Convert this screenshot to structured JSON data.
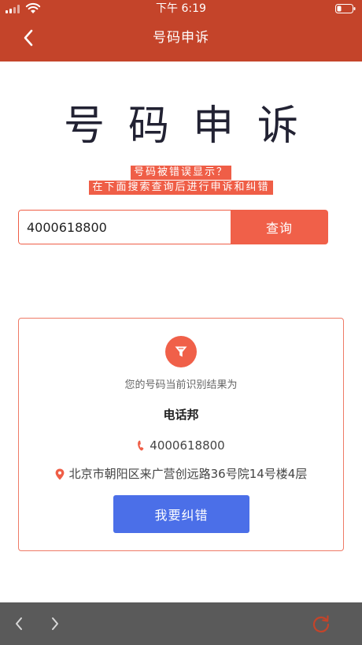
{
  "status_bar": {
    "time": "下午 6:19"
  },
  "nav": {
    "title": "号码申诉"
  },
  "hero": {
    "title": "号码申诉",
    "hint_line_1": "号码被错误显示？",
    "hint_line_2": "在下面搜索查询后进行申诉和纠错"
  },
  "search": {
    "value": "4000618800",
    "button_label": "查询"
  },
  "result": {
    "caption": "您的号码当前识别结果为",
    "name": "电话邦",
    "phone": "4000618800",
    "address": "北京市朝阳区来广营创远路36号院14号楼4层",
    "correct_button_label": "我要纠错"
  },
  "icons": {
    "back": "chevron-left-icon",
    "filter": "filter-icon",
    "phone": "phone-icon",
    "location": "location-pin-icon",
    "toolbar_back": "chevron-left-icon",
    "toolbar_forward": "chevron-right-icon",
    "toolbar_reload": "reload-icon"
  },
  "colors": {
    "header": "#c4442a",
    "accent": "#f06049",
    "primary_button": "#4b6fe8",
    "toolbar": "#5a5a5a"
  }
}
